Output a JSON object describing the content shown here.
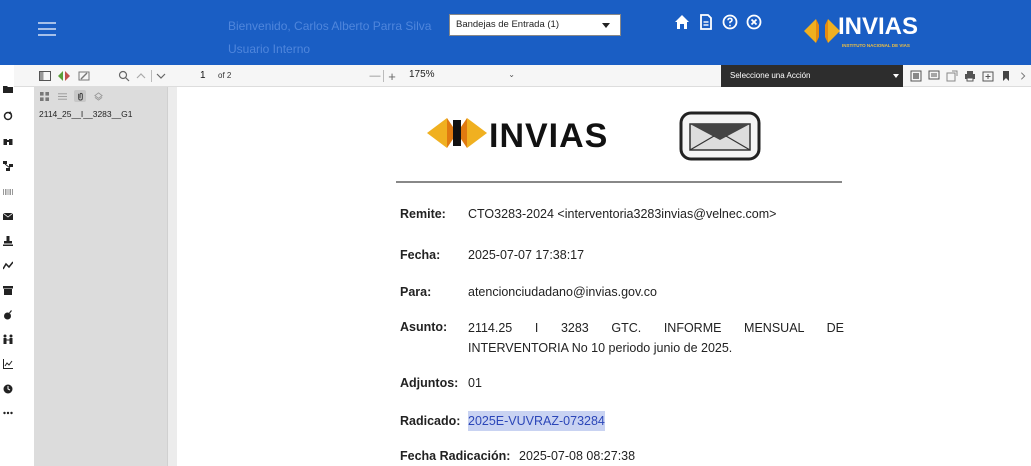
{
  "header": {
    "welcome_line1": "Bienvenido, Carlos Alberto Parra Silva",
    "welcome_line2": "Usuario Interno",
    "inbox_select": "Bandejas de Entrada (1)",
    "logo_text": "INVIAS",
    "logo_subtitle": "INSTITUTO NACIONAL DE VIAS",
    "icons": [
      "home-icon",
      "document-icon",
      "help-icon",
      "close-circle-icon"
    ],
    "brand_color": "#1a5ec4"
  },
  "toolbar": {
    "page_current": "1",
    "page_of": "of 2",
    "zoom": "175%",
    "action_select": "Seleccione una Acción",
    "minus": "—",
    "plus": "+"
  },
  "sidebar": {
    "attachment_item": "2114_25__I__3283__G1"
  },
  "email": {
    "logo_text": "INVIAS",
    "remite_label": "Remite:",
    "remite_value": "CTO3283-2024 <interventoria3283invias@velnec.com>",
    "fecha_label": "Fecha:",
    "fecha_value": "2025-07-07 17:38:17",
    "para_label": "Para:",
    "para_value": "atencionciudadano@invias.gov.co",
    "asunto_label": "Asunto:",
    "asunto_value_line1": "2114.25 I 3283 GTC. INFORME MENSUAL DE",
    "asunto_value_line2": "INTERVENTORIA No 10 periodo junio de 2025.",
    "adjuntos_label": "Adjuntos:",
    "adjuntos_value": "01",
    "radicado_label": "Radicado:",
    "radicado_value": "2025E-VUVRAZ-073284",
    "fecha_radicacion_label": "Fecha Radicación:",
    "fecha_radicacion_value": "2025-07-08 08:27:38"
  }
}
